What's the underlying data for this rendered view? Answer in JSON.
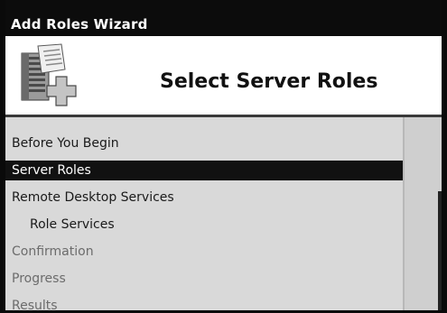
{
  "window": {
    "title": "Add Roles Wizard"
  },
  "header": {
    "page_title": "Select Server Roles",
    "icon": "server-add-icon"
  },
  "sidebar": {
    "items": [
      {
        "label": "Before You Begin",
        "state": "normal"
      },
      {
        "label": "Server Roles",
        "state": "selected"
      },
      {
        "label": "Remote Desktop Services",
        "state": "normal"
      },
      {
        "label": "Role Services",
        "state": "normal"
      },
      {
        "label": "Confirmation",
        "state": "disabled"
      },
      {
        "label": "Progress",
        "state": "disabled"
      },
      {
        "label": "Results",
        "state": "disabled"
      }
    ]
  },
  "colors": {
    "titlebar": "#0c0c0c",
    "selected_item": "#111111",
    "sidebar_bg": "#d9d9d9",
    "disabled_text": "#6c6c6c"
  }
}
